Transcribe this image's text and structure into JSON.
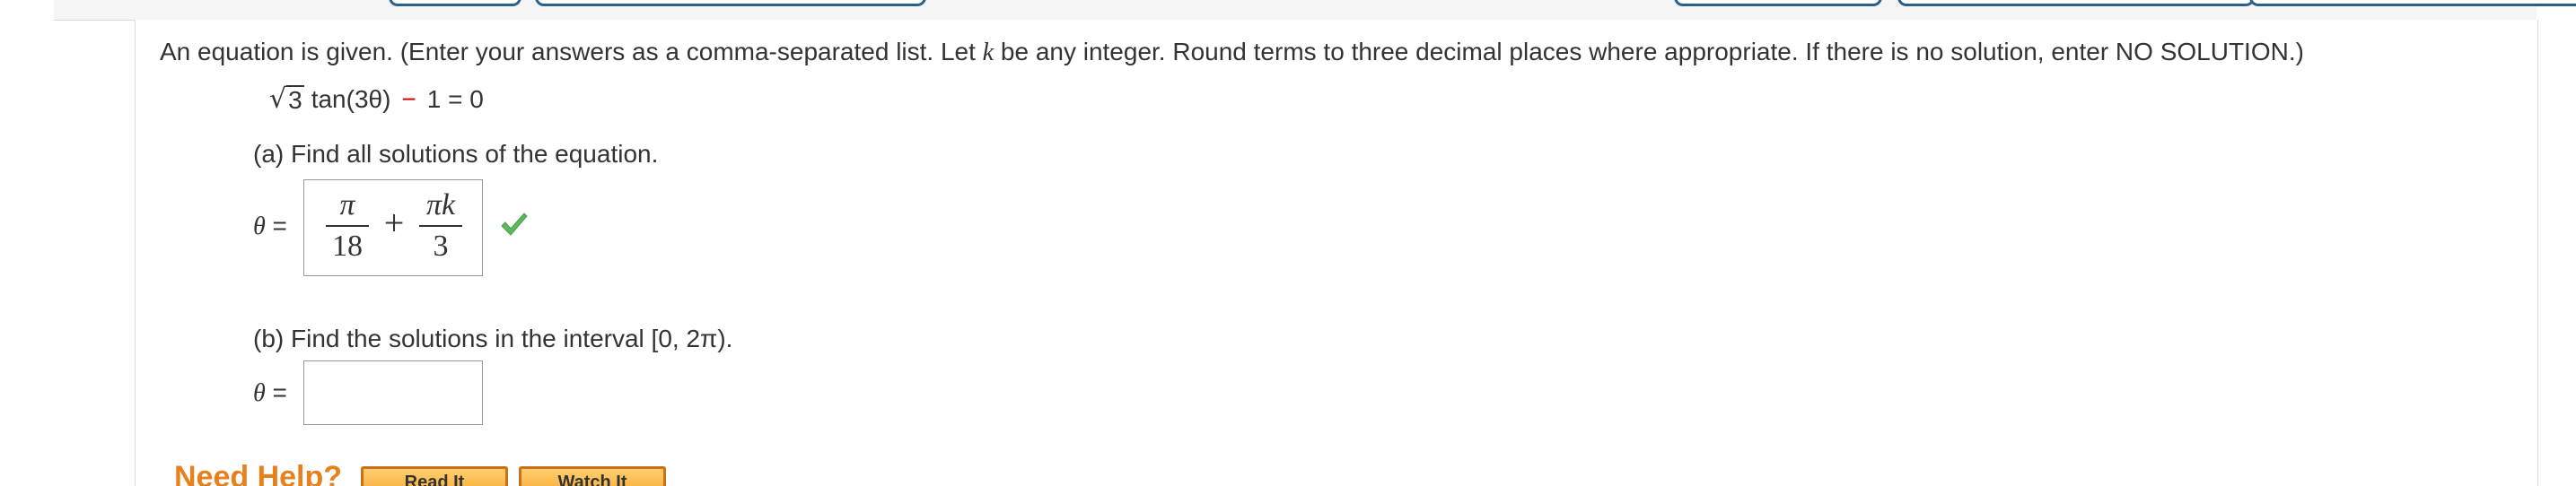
{
  "instructions": {
    "part1": "An equation is given. (Enter your answers as a comma-separated list. Let ",
    "var_k": "k",
    "part2": " be any integer. Round terms to three decimal places where appropriate. If there is no solution, enter NO SOLUTION.)"
  },
  "equation": {
    "sqrt_sign": "√",
    "radicand": "3",
    "func": "tan(3θ)",
    "minus": "−",
    "rest": "1 = 0"
  },
  "part_a": {
    "label": "(a) Find all solutions of the equation.",
    "theta_var": "θ",
    "equals": " =",
    "answer": {
      "frac1_num": "π",
      "frac1_den": "18",
      "plus": "+",
      "frac2_num": "πk",
      "frac2_den": "3"
    },
    "status": "correct",
    "status_icon": "check-icon",
    "status_color": "#5cb85c"
  },
  "part_b": {
    "label": "(b) Find the solutions in the interval [0, 2π).",
    "theta_var": "θ",
    "equals": " =",
    "answer_value": ""
  },
  "help": {
    "title": "Need Help?",
    "read_label": "Read It",
    "watch_label": "Watch It",
    "accent_color": "#e8811c"
  },
  "colors": {
    "tab_border": "#2c5f8a",
    "minus_red": "#cc0000"
  }
}
